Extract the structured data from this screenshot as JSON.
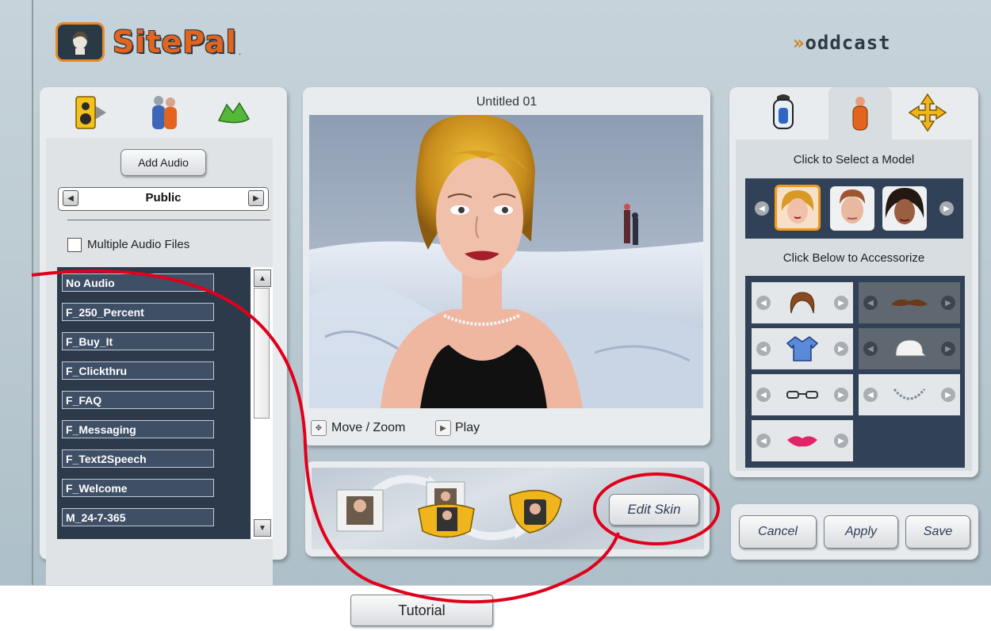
{
  "brand": {
    "logo_text": "SitePal",
    "logo_dot": ".",
    "partner_logo": "oddcast"
  },
  "audio_panel": {
    "tabs": [
      {
        "icon": "speaker-icon",
        "active": true
      },
      {
        "icon": "people-icon",
        "active": false
      },
      {
        "icon": "background-scene-icon",
        "active": false
      }
    ],
    "add_audio_label": "Add Audio",
    "category": {
      "value": "Public"
    },
    "multiple_audio_label": "Multiple Audio Files",
    "audio_files": [
      "No Audio",
      "F_250_Percent",
      "F_Buy_It",
      "F_Clickthru",
      "F_FAQ",
      "F_Messaging",
      "F_Text2Speech",
      "F_Welcome",
      "M_24-7-365"
    ]
  },
  "preview": {
    "title": "Untitled 01",
    "move_zoom_label": "Move / Zoom",
    "play_label": "Play",
    "edit_skin_label": "Edit Skin"
  },
  "model_panel": {
    "tabs": [
      {
        "icon": "lantern-icon",
        "active": false
      },
      {
        "icon": "model-icon",
        "active": true
      },
      {
        "icon": "move-arrows-icon",
        "active": false
      }
    ],
    "select_model_label": "Click to Select a Model",
    "accessorize_label": "Click Below to Accessorize",
    "models": [
      "blonde-woman-model",
      "man-model",
      "dark-haired-woman-model"
    ],
    "accessories": [
      {
        "name": "hair",
        "enabled": true
      },
      {
        "name": "mustache",
        "enabled": false
      },
      {
        "name": "shirt",
        "enabled": true
      },
      {
        "name": "cap",
        "enabled": false
      },
      {
        "name": "glasses",
        "enabled": true
      },
      {
        "name": "necklace",
        "enabled": true
      },
      {
        "name": "lips",
        "enabled": true
      }
    ]
  },
  "actions": {
    "cancel_label": "Cancel",
    "apply_label": "Apply",
    "save_label": "Save"
  },
  "footer": {
    "tutorial_label": "Tutorial"
  },
  "colors": {
    "annotation": "#e0001b",
    "brand_orange": "#e3651d",
    "list_bg": "#2d3a4c"
  }
}
